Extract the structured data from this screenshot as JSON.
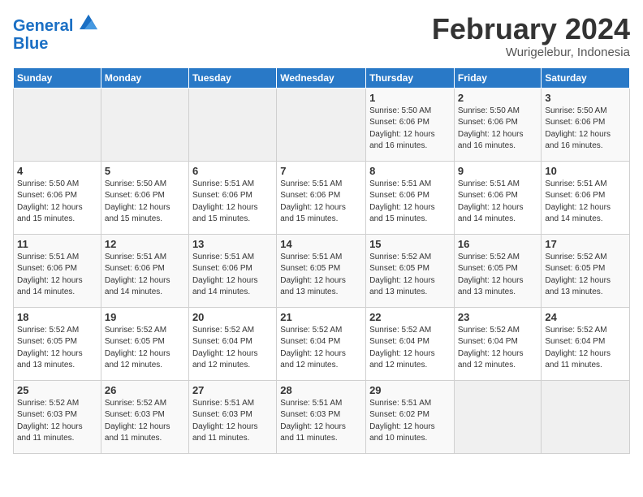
{
  "header": {
    "logo_line1": "General",
    "logo_line2": "Blue",
    "month": "February 2024",
    "location": "Wurigelebur, Indonesia"
  },
  "days_of_week": [
    "Sunday",
    "Monday",
    "Tuesday",
    "Wednesday",
    "Thursday",
    "Friday",
    "Saturday"
  ],
  "weeks": [
    [
      {
        "num": "",
        "detail": ""
      },
      {
        "num": "",
        "detail": ""
      },
      {
        "num": "",
        "detail": ""
      },
      {
        "num": "",
        "detail": ""
      },
      {
        "num": "1",
        "detail": "Sunrise: 5:50 AM\nSunset: 6:06 PM\nDaylight: 12 hours\nand 16 minutes."
      },
      {
        "num": "2",
        "detail": "Sunrise: 5:50 AM\nSunset: 6:06 PM\nDaylight: 12 hours\nand 16 minutes."
      },
      {
        "num": "3",
        "detail": "Sunrise: 5:50 AM\nSunset: 6:06 PM\nDaylight: 12 hours\nand 16 minutes."
      }
    ],
    [
      {
        "num": "4",
        "detail": "Sunrise: 5:50 AM\nSunset: 6:06 PM\nDaylight: 12 hours\nand 15 minutes."
      },
      {
        "num": "5",
        "detail": "Sunrise: 5:50 AM\nSunset: 6:06 PM\nDaylight: 12 hours\nand 15 minutes."
      },
      {
        "num": "6",
        "detail": "Sunrise: 5:51 AM\nSunset: 6:06 PM\nDaylight: 12 hours\nand 15 minutes."
      },
      {
        "num": "7",
        "detail": "Sunrise: 5:51 AM\nSunset: 6:06 PM\nDaylight: 12 hours\nand 15 minutes."
      },
      {
        "num": "8",
        "detail": "Sunrise: 5:51 AM\nSunset: 6:06 PM\nDaylight: 12 hours\nand 15 minutes."
      },
      {
        "num": "9",
        "detail": "Sunrise: 5:51 AM\nSunset: 6:06 PM\nDaylight: 12 hours\nand 14 minutes."
      },
      {
        "num": "10",
        "detail": "Sunrise: 5:51 AM\nSunset: 6:06 PM\nDaylight: 12 hours\nand 14 minutes."
      }
    ],
    [
      {
        "num": "11",
        "detail": "Sunrise: 5:51 AM\nSunset: 6:06 PM\nDaylight: 12 hours\nand 14 minutes."
      },
      {
        "num": "12",
        "detail": "Sunrise: 5:51 AM\nSunset: 6:06 PM\nDaylight: 12 hours\nand 14 minutes."
      },
      {
        "num": "13",
        "detail": "Sunrise: 5:51 AM\nSunset: 6:06 PM\nDaylight: 12 hours\nand 14 minutes."
      },
      {
        "num": "14",
        "detail": "Sunrise: 5:51 AM\nSunset: 6:05 PM\nDaylight: 12 hours\nand 13 minutes."
      },
      {
        "num": "15",
        "detail": "Sunrise: 5:52 AM\nSunset: 6:05 PM\nDaylight: 12 hours\nand 13 minutes."
      },
      {
        "num": "16",
        "detail": "Sunrise: 5:52 AM\nSunset: 6:05 PM\nDaylight: 12 hours\nand 13 minutes."
      },
      {
        "num": "17",
        "detail": "Sunrise: 5:52 AM\nSunset: 6:05 PM\nDaylight: 12 hours\nand 13 minutes."
      }
    ],
    [
      {
        "num": "18",
        "detail": "Sunrise: 5:52 AM\nSunset: 6:05 PM\nDaylight: 12 hours\nand 13 minutes."
      },
      {
        "num": "19",
        "detail": "Sunrise: 5:52 AM\nSunset: 6:05 PM\nDaylight: 12 hours\nand 12 minutes."
      },
      {
        "num": "20",
        "detail": "Sunrise: 5:52 AM\nSunset: 6:04 PM\nDaylight: 12 hours\nand 12 minutes."
      },
      {
        "num": "21",
        "detail": "Sunrise: 5:52 AM\nSunset: 6:04 PM\nDaylight: 12 hours\nand 12 minutes."
      },
      {
        "num": "22",
        "detail": "Sunrise: 5:52 AM\nSunset: 6:04 PM\nDaylight: 12 hours\nand 12 minutes."
      },
      {
        "num": "23",
        "detail": "Sunrise: 5:52 AM\nSunset: 6:04 PM\nDaylight: 12 hours\nand 12 minutes."
      },
      {
        "num": "24",
        "detail": "Sunrise: 5:52 AM\nSunset: 6:04 PM\nDaylight: 12 hours\nand 11 minutes."
      }
    ],
    [
      {
        "num": "25",
        "detail": "Sunrise: 5:52 AM\nSunset: 6:03 PM\nDaylight: 12 hours\nand 11 minutes."
      },
      {
        "num": "26",
        "detail": "Sunrise: 5:52 AM\nSunset: 6:03 PM\nDaylight: 12 hours\nand 11 minutes."
      },
      {
        "num": "27",
        "detail": "Sunrise: 5:51 AM\nSunset: 6:03 PM\nDaylight: 12 hours\nand 11 minutes."
      },
      {
        "num": "28",
        "detail": "Sunrise: 5:51 AM\nSunset: 6:03 PM\nDaylight: 12 hours\nand 11 minutes."
      },
      {
        "num": "29",
        "detail": "Sunrise: 5:51 AM\nSunset: 6:02 PM\nDaylight: 12 hours\nand 10 minutes."
      },
      {
        "num": "",
        "detail": ""
      },
      {
        "num": "",
        "detail": ""
      }
    ]
  ]
}
